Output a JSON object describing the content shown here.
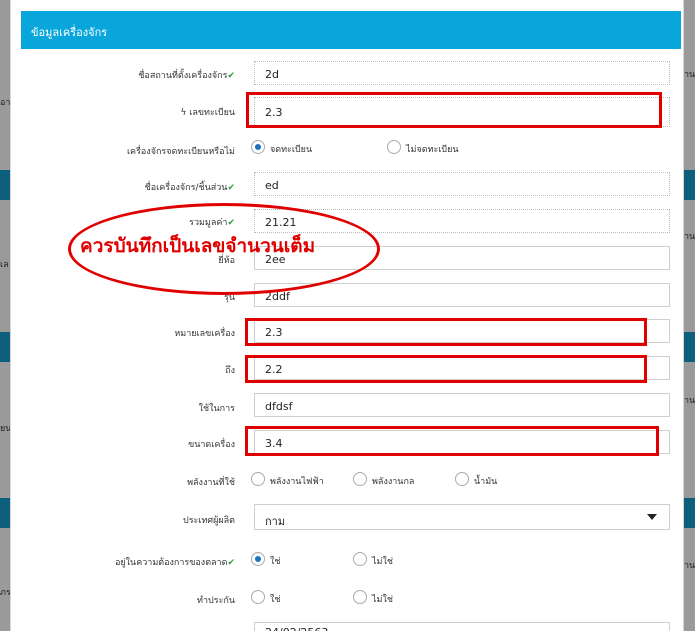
{
  "background": {
    "fragments": [
      "าน",
      "ิอา",
      "าน",
      "เล",
      "าน",
      "ยน",
      "าน",
      "ภร"
    ]
  },
  "modal": {
    "header_title": "ข้อมูลเครื่องจักร",
    "fields": [
      {
        "key": "location",
        "label": "ชื่อสถานที่ตั้งเครื่องจักร",
        "check": "✔",
        "value": "2d"
      },
      {
        "key": "reg_no",
        "label": "เลขทะเบียน",
        "icon": "ϟ",
        "value": "2.3"
      },
      {
        "key": "reg_status",
        "label": "เครื่องจักรจดทะเบียนหรือไม่",
        "options": [
          "จดทะเบียน",
          "ไม่จดทะเบียน"
        ]
      },
      {
        "key": "machine_name",
        "label": "ชื่อเครื่องจักร/ชิ้นส่วน",
        "check": "✔",
        "value": "ed"
      },
      {
        "key": "total_value",
        "label": "รวมมูลค่า",
        "check": "✔",
        "value": "21.21"
      },
      {
        "key": "brand",
        "label": "ยี่ห้อ",
        "value": "2ee"
      },
      {
        "key": "model",
        "label": "รุ่น",
        "value": "2ddf"
      },
      {
        "key": "serial",
        "label": "หมายเลขเครื่อง",
        "value": "2.3"
      },
      {
        "key": "to",
        "label": "ถึง",
        "value": "2.2"
      },
      {
        "key": "usage",
        "label": "ใช้ในการ",
        "value": "dfdsf"
      },
      {
        "key": "size",
        "label": "ขนาดเครื่อง",
        "value": "3.4"
      },
      {
        "key": "energy",
        "label": "พลังงานที่ใช้",
        "options": [
          "พลังงานไฟฟ้า",
          "พลังงานกล",
          "น้ำมัน"
        ]
      },
      {
        "key": "country",
        "label": "ประเทศผู้ผลิต",
        "value": "กาม"
      },
      {
        "key": "in_market",
        "label": "อยู่ในความต้องการของตลาด",
        "check": "✔",
        "options": [
          "ใช่",
          "ไม่ใช่"
        ]
      },
      {
        "key": "insured",
        "label": "ทำประกัน",
        "options": [
          "ใช่",
          "ไม่ใช่"
        ]
      }
    ],
    "partial_value": "24/02/2563"
  },
  "annotation": {
    "note": "ควรบันทึกเป็นเลขจำนวนเต็ม",
    "color": "#e00000"
  },
  "colors": {
    "header_bg": "#09a6dc",
    "radio_selected": "#1e73be",
    "check": "#2e9b3a"
  }
}
